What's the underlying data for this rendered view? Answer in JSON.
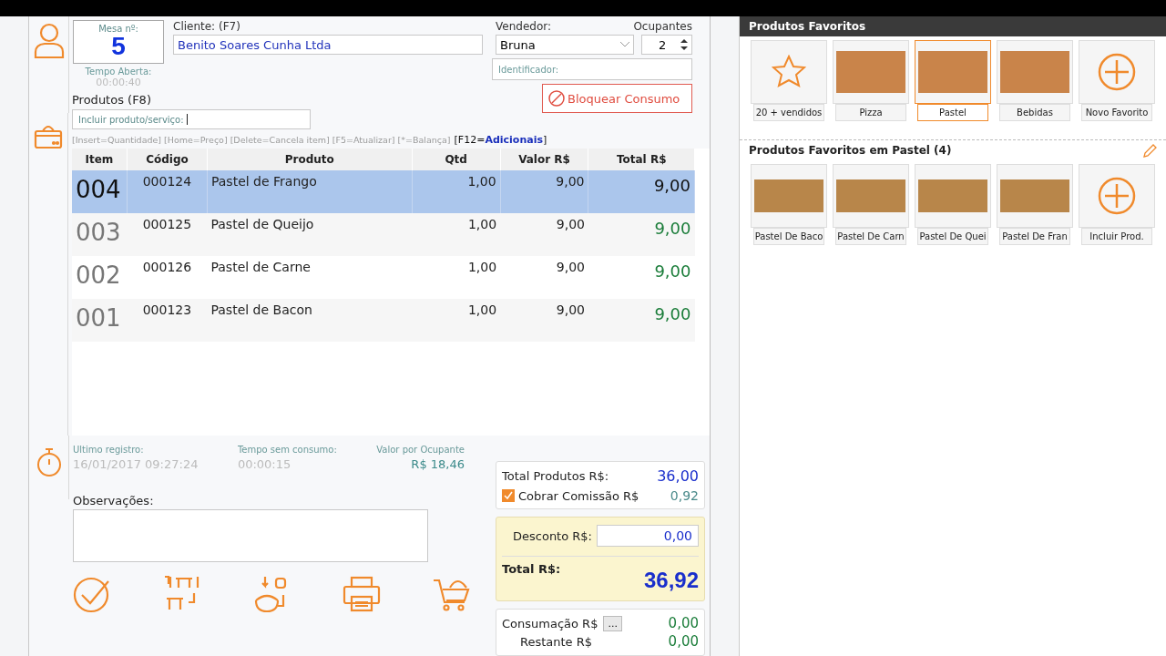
{
  "mesa": {
    "label": "Mesa nº:",
    "number": "5"
  },
  "tempo_aberta": {
    "label": "Tempo Aberta:",
    "value": "00:00:40"
  },
  "cliente": {
    "label": "Cliente: (F7)",
    "value": "Benito Soares Cunha Ltda"
  },
  "vendedor": {
    "label": "Vendedor:",
    "value": "Bruna"
  },
  "ocupantes": {
    "label": "Ocupantes",
    "value": "2"
  },
  "identificador": {
    "placeholder": "Identificador:"
  },
  "bloquear_button": "Bloquear Consumo",
  "produtos": {
    "title": "Produtos (F8)",
    "search_placeholder": "Incluir produto/serviço:",
    "shortcuts": "[Insert=Quantidade] [Home=Preço] [Delete=Cancela item] [F5=Atualizar] [*=Balança]",
    "shortcut_f12": "[F12=**Adicionais**]"
  },
  "table": {
    "columns": [
      "Item",
      "Código",
      "Produto",
      "Qtd",
      "Valor R$",
      "Total R$"
    ],
    "rows": [
      {
        "item": "004",
        "codigo": "000124",
        "produto": "Pastel de Frango",
        "qtd": "1,00",
        "valor": "9,00",
        "total": "9,00",
        "selected": true
      },
      {
        "item": "003",
        "codigo": "000125",
        "produto": "Pastel de Queijo",
        "qtd": "1,00",
        "valor": "9,00",
        "total": "9,00",
        "selected": false
      },
      {
        "item": "002",
        "codigo": "000126",
        "produto": "Pastel de Carne",
        "qtd": "1,00",
        "valor": "9,00",
        "total": "9,00",
        "selected": false
      },
      {
        "item": "001",
        "codigo": "000123",
        "produto": "Pastel de Bacon",
        "qtd": "1,00",
        "valor": "9,00",
        "total": "9,00",
        "selected": false
      }
    ]
  },
  "ultimo_registro": {
    "label": "Ultimo registro:",
    "value": "16/01/2017 09:27:24"
  },
  "tempo_sem_consumo": {
    "label": "Tempo sem consumo:",
    "value": "00:00:15"
  },
  "valor_por_ocupante": {
    "label": "Valor por Ocupante",
    "value": "R$ 18,46"
  },
  "observacoes": {
    "label": "Observações:"
  },
  "totals": {
    "total_produtos": {
      "label": "Total Produtos R$:",
      "value": "36,00"
    },
    "comissao": {
      "label": "Cobrar Comissão R$",
      "checked": true,
      "value": "0,92"
    },
    "desconto": {
      "label": "Desconto R$:",
      "value": "0,00"
    },
    "total": {
      "label": "Total R$:",
      "value": "36,92"
    },
    "consumacao": {
      "label": "Consumação R$",
      "button": "...",
      "value": "0,00"
    },
    "restante": {
      "label": "Restante R$",
      "value": "0,00"
    }
  },
  "action_buttons": [
    {
      "kind": "check"
    },
    {
      "kind": "table-transfer"
    },
    {
      "kind": "item-transfer"
    },
    {
      "kind": "print"
    },
    {
      "kind": "cart"
    }
  ],
  "favoritos": {
    "title": "Produtos Favoritos",
    "items": [
      {
        "label": "20 + vendidos",
        "kind": "star",
        "selected": false
      },
      {
        "label": "Pizza",
        "kind": "photo",
        "selected": false
      },
      {
        "label": "Pastel",
        "kind": "photo",
        "selected": true
      },
      {
        "label": "Bebidas",
        "kind": "photo",
        "selected": false
      },
      {
        "label": "Novo Favorito",
        "kind": "add",
        "selected": false
      }
    ]
  },
  "favoritos_categoria": {
    "title": "Produtos Favoritos em Pastel (4)",
    "items": [
      {
        "label": "Pastel De Baco",
        "kind": "photo"
      },
      {
        "label": "Pastel De Carn",
        "kind": "photo"
      },
      {
        "label": "Pastel De Quei",
        "kind": "photo"
      },
      {
        "label": "Pastel De Fran",
        "kind": "photo"
      },
      {
        "label": "Incluir Prod.",
        "kind": "add"
      }
    ]
  }
}
